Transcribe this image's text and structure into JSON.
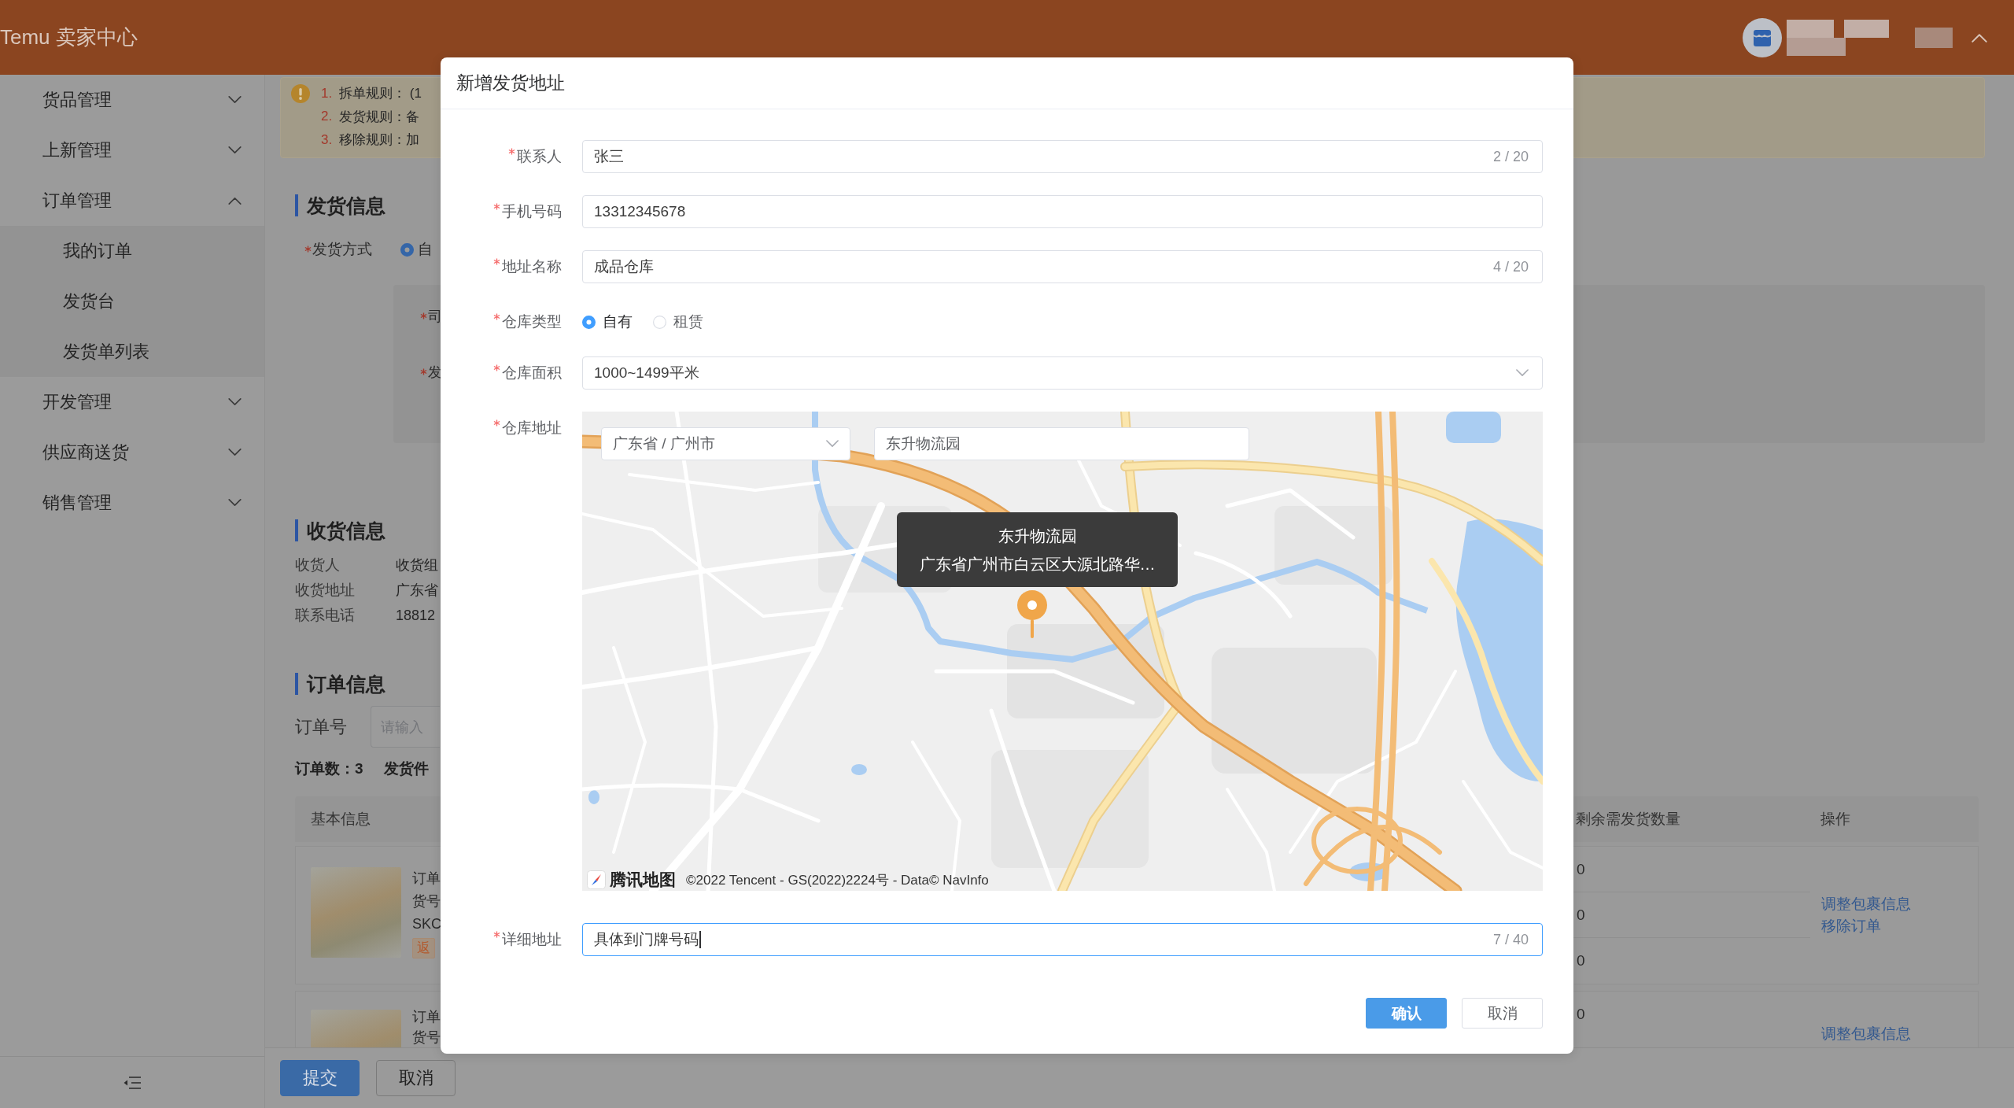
{
  "header": {
    "title": "Temu 卖家中心"
  },
  "sidebar": {
    "items": [
      {
        "label": "货品管理",
        "expanded": false
      },
      {
        "label": "上新管理",
        "expanded": false
      },
      {
        "label": "订单管理",
        "expanded": true,
        "children": [
          {
            "label": "我的订单",
            "selected": false
          },
          {
            "label": "发货台",
            "selected": false
          },
          {
            "label": "发货单列表",
            "selected": false
          }
        ]
      },
      {
        "label": "开发管理",
        "expanded": false
      },
      {
        "label": "供应商送货",
        "expanded": false
      },
      {
        "label": "销售管理",
        "expanded": false
      }
    ]
  },
  "notice": {
    "items": [
      {
        "number": "1.",
        "text": "拆单规则： (1"
      },
      {
        "number": "2.",
        "text": "发货规则：备"
      },
      {
        "number": "3.",
        "text": "移除规则：加"
      }
    ]
  },
  "shipping_info": {
    "title": "发货信息",
    "method": {
      "label": "发货方式",
      "required": true,
      "options": [
        {
          "label": "自",
          "selected": true
        }
      ]
    },
    "panel_fields": [
      {
        "label": "司",
        "required": true
      },
      {
        "label": "发",
        "required": true
      }
    ]
  },
  "receiving_info": {
    "title": "收货信息",
    "rows": [
      {
        "label": "收货人",
        "value": "收货组"
      },
      {
        "label": "收货地址",
        "value": "广东省"
      },
      {
        "label": "联系电话",
        "value": "18812"
      }
    ]
  },
  "order_info": {
    "title": "订单信息",
    "search": {
      "label": "订单号",
      "placeholder": "请输入"
    },
    "summary": [
      "订单数：3",
      "发货件"
    ]
  },
  "table": {
    "columns": [
      "基本信息",
      "剩余需发货数量",
      "操作"
    ],
    "rows": [
      {
        "lines": [
          "订单",
          "货号",
          "SKC"
        ],
        "tag": "返",
        "remaining": [
          "0",
          "0",
          "0"
        ],
        "actions": [
          "调整包裹信息",
          "移除订单"
        ]
      },
      {
        "lines": [
          "订单",
          "货号"
        ],
        "remaining": [
          "0"
        ],
        "actions": [
          "调整包裹信息"
        ]
      }
    ]
  },
  "footer_buttons": [
    {
      "label": "提交",
      "kind": "primary"
    },
    {
      "label": "取消",
      "kind": "default"
    }
  ],
  "dialog": {
    "title": "新增发货地址",
    "fields": [
      {
        "kind": "text",
        "label": "联系人",
        "required": true,
        "value": "张三",
        "counter": "2 / 20",
        "focused": false
      },
      {
        "kind": "text",
        "label": "手机号码",
        "required": true,
        "value": "13312345678",
        "focused": false
      },
      {
        "kind": "text",
        "label": "地址名称",
        "required": true,
        "value": "成品仓库",
        "counter": "4 / 20",
        "focused": false
      },
      {
        "kind": "radio",
        "label": "仓库类型",
        "required": true,
        "options": [
          {
            "label": "自有",
            "selected": true
          },
          {
            "label": "租赁",
            "selected": false
          }
        ]
      },
      {
        "kind": "select",
        "label": "仓库面积",
        "required": true,
        "value": "1000~1499平米"
      },
      {
        "kind": "map",
        "label": "仓库地址",
        "required": true,
        "region": "广东省 / 广州市",
        "search": "东升物流园",
        "info_window": {
          "title": "东升物流园",
          "address": "广东省广州市白云区大源北路华…"
        },
        "attribution": {
          "brand": "腾讯地图",
          "text": "©2022 Tencent - GS(2022)2224号 - Data© NavInfo"
        }
      },
      {
        "kind": "text",
        "label": "详细地址",
        "required": true,
        "value": "具体到门牌号码",
        "counter": "7 / 40",
        "focused": true
      }
    ],
    "buttons": [
      {
        "label": "确认",
        "kind": "primary"
      },
      {
        "label": "取消",
        "kind": "default"
      }
    ]
  }
}
